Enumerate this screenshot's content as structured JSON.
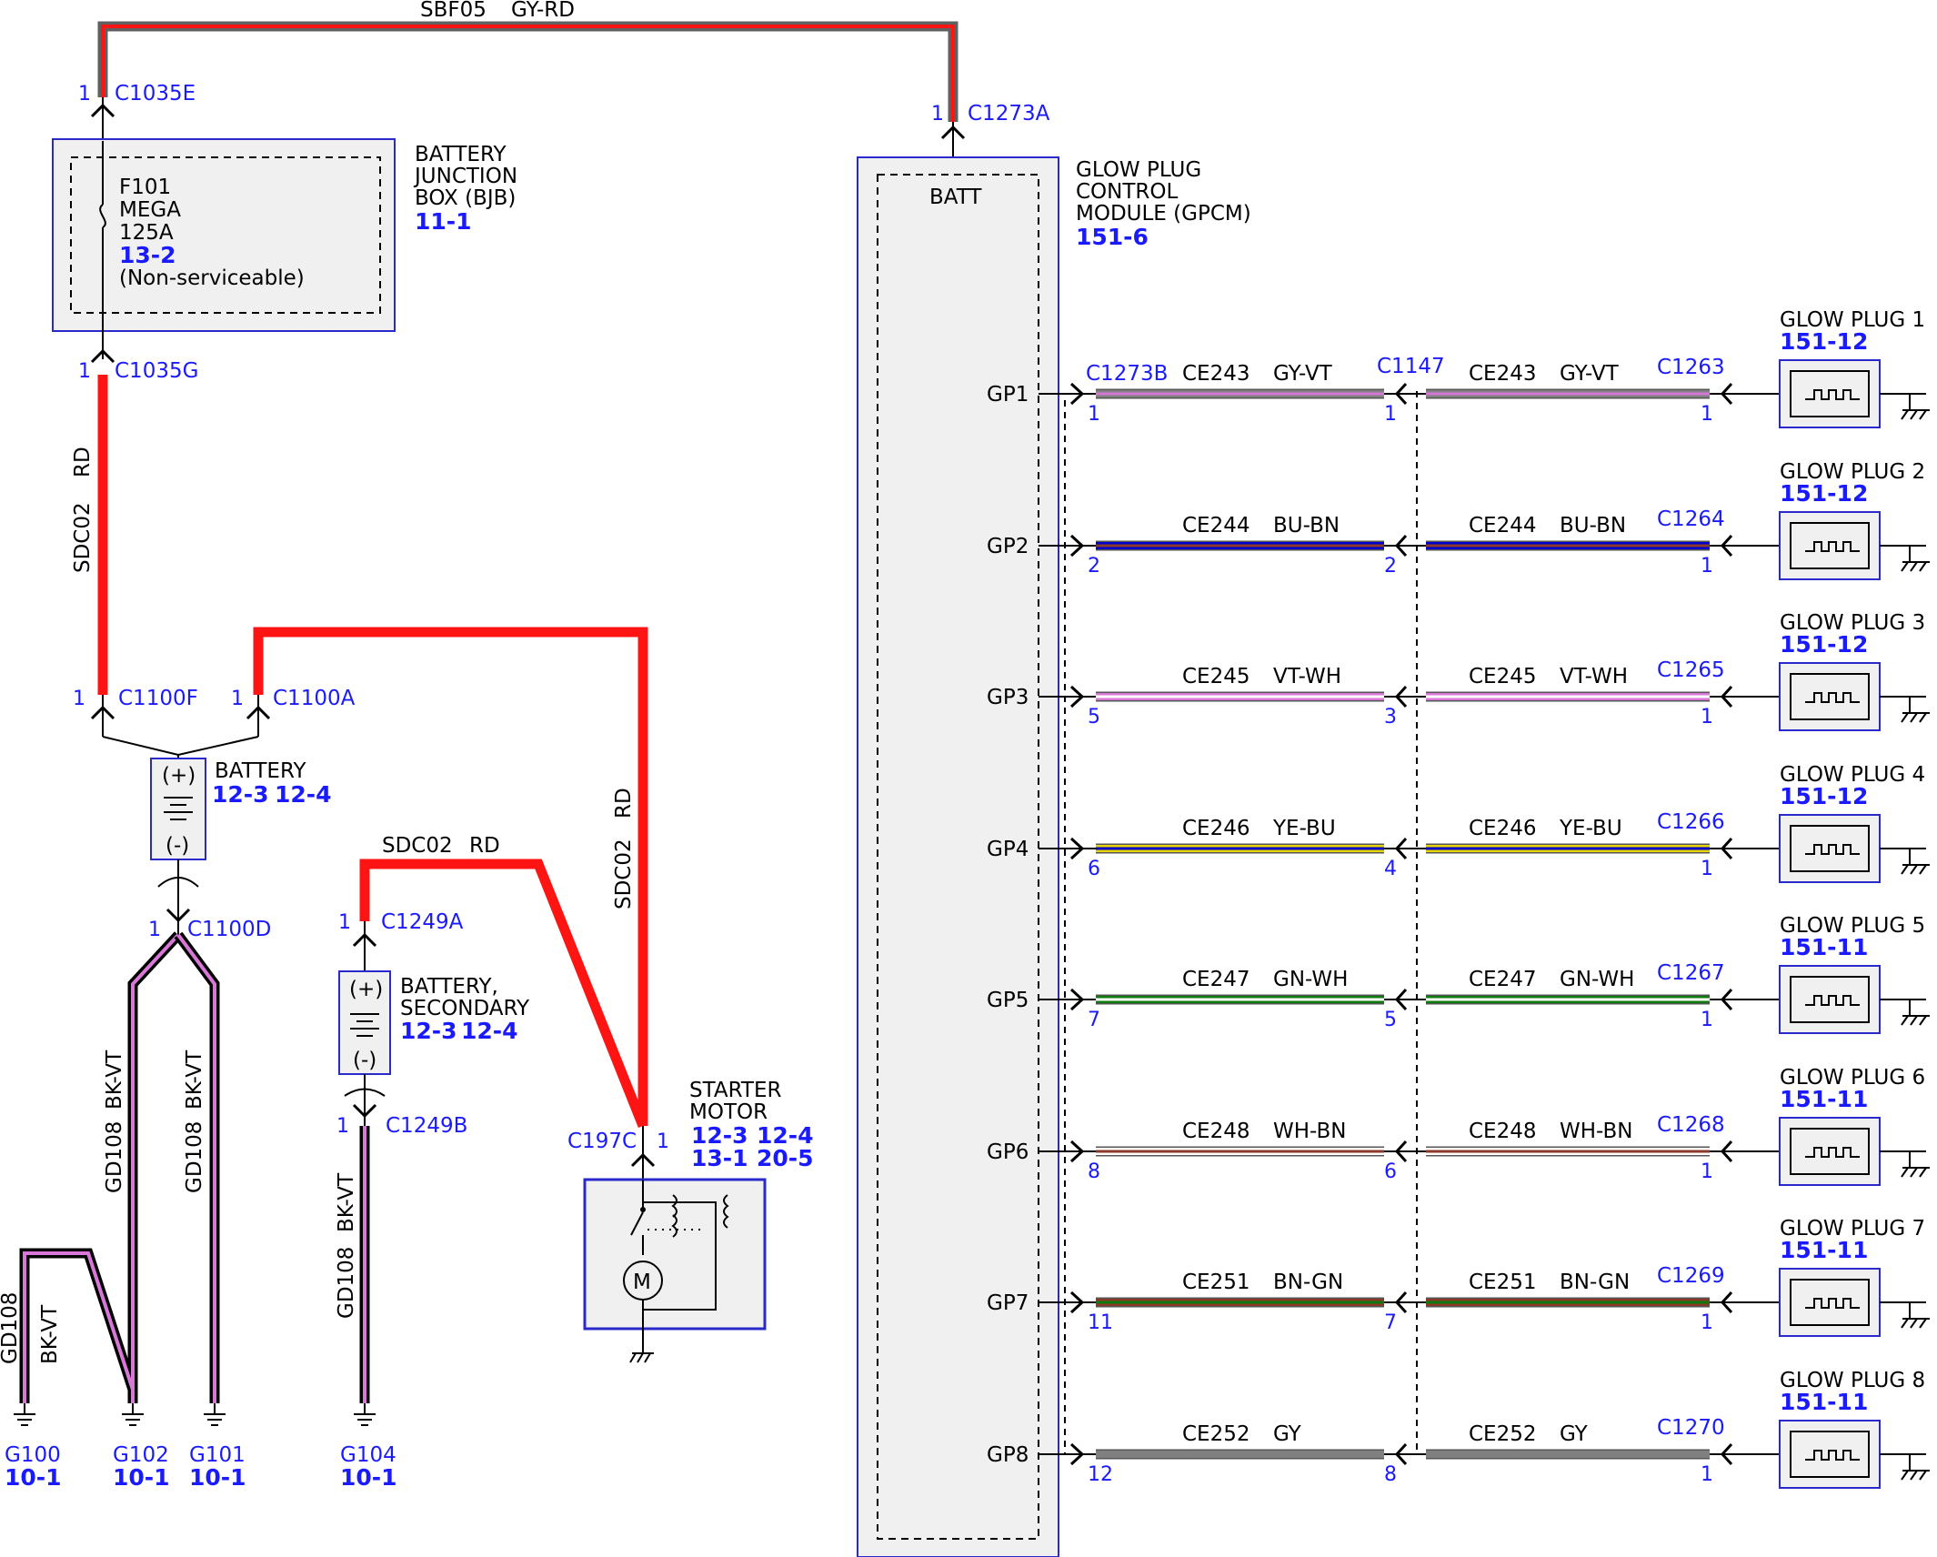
{
  "colors": {
    "red": "#ff1414",
    "gy": "#808080",
    "vt": "#d977d9",
    "bu": "#0000cc",
    "bn": "#8b3a2a",
    "gn": "#0e7a0e",
    "ye": "#e6d400",
    "wh": "#ffffff",
    "blue_text": "#1a1aff",
    "module_fill": "#f0f0f0",
    "module_border": "#2a2acc"
  },
  "top_wire": {
    "circuit": "SBF05",
    "color": "GY-RD"
  },
  "bjb": {
    "title_lines": [
      "BATTERY",
      "JUNCTION",
      "BOX (BJB)"
    ],
    "ref": "11-1",
    "fuse_lines": [
      "F101",
      "MEGA",
      "125A"
    ],
    "fuse_ref": "13-2",
    "fuse_note": "(Non-serviceable)",
    "conn_top": {
      "pin": "1",
      "name": "C1035E"
    },
    "conn_bottom": {
      "pin": "1",
      "name": "C1035G"
    }
  },
  "sdc02_vertical": {
    "circuit": "SDC02",
    "color": "RD"
  },
  "c1100f": {
    "pin": "1",
    "name": "C1100F"
  },
  "c1100a": {
    "pin": "1",
    "name": "C1100A"
  },
  "battery": {
    "title": "BATTERY",
    "refs": [
      "12-3",
      "12-4"
    ],
    "plus": "(+)",
    "minus": "(-)"
  },
  "c1100d": {
    "pin": "1",
    "name": "C1100D"
  },
  "ground_wires": {
    "circuit": "GD108",
    "color": "BK-VT"
  },
  "grounds": [
    {
      "name": "G100",
      "ref": "10-1"
    },
    {
      "name": "G102",
      "ref": "10-1"
    },
    {
      "name": "G101",
      "ref": "10-1"
    },
    {
      "name": "G104",
      "ref": "10-1"
    }
  ],
  "secondary_battery": {
    "title_lines": [
      "BATTERY,",
      "SECONDARY"
    ],
    "refs": [
      "12-3",
      "12-4"
    ],
    "plus": "(+)",
    "minus": "(-)",
    "conn_top": {
      "pin": "1",
      "name": "C1249A"
    },
    "conn_bottom": {
      "pin": "1",
      "name": "C1249B"
    }
  },
  "sdc02_diag": {
    "circuit": "SDC02",
    "color": "RD"
  },
  "sdc02_right": {
    "circuit": "SDC02",
    "color": "RD"
  },
  "starter": {
    "title_lines": [
      "STARTER",
      "MOTOR"
    ],
    "refs_row1": [
      "12-3",
      "12-4"
    ],
    "refs_row2": [
      "13-1",
      "20-5"
    ],
    "conn": {
      "name": "C197C",
      "pin": "1"
    },
    "motor_letter": "M"
  },
  "gpcm": {
    "title_lines": [
      "GLOW PLUG",
      "CONTROL",
      "MODULE (GPCM)"
    ],
    "ref": "151-6",
    "batt": "BATT",
    "conn_batt": {
      "pin": "1",
      "name": "C1273A"
    },
    "left_conn": "C1273B",
    "mid_conn": "C1147"
  },
  "glow_plugs": [
    {
      "gp": "GP1",
      "circuit": "CE243",
      "color": "GY-VT",
      "pin_a": "1",
      "pin_b": "1",
      "pin_c": "1",
      "conn": "C1263",
      "title": "GLOW PLUG 1",
      "ref": "151-12"
    },
    {
      "gp": "GP2",
      "circuit": "CE244",
      "color": "BU-BN",
      "pin_a": "2",
      "pin_b": "2",
      "pin_c": "1",
      "conn": "C1264",
      "title": "GLOW PLUG 2",
      "ref": "151-12"
    },
    {
      "gp": "GP3",
      "circuit": "CE245",
      "color": "VT-WH",
      "pin_a": "5",
      "pin_b": "3",
      "pin_c": "1",
      "conn": "C1265",
      "title": "GLOW PLUG 3",
      "ref": "151-12"
    },
    {
      "gp": "GP4",
      "circuit": "CE246",
      "color": "YE-BU",
      "pin_a": "6",
      "pin_b": "4",
      "pin_c": "1",
      "conn": "C1266",
      "title": "GLOW PLUG 4",
      "ref": "151-12"
    },
    {
      "gp": "GP5",
      "circuit": "CE247",
      "color": "GN-WH",
      "pin_a": "7",
      "pin_b": "5",
      "pin_c": "1",
      "conn": "C1267",
      "title": "GLOW PLUG 5",
      "ref": "151-11"
    },
    {
      "gp": "GP6",
      "circuit": "CE248",
      "color": "WH-BN",
      "pin_a": "8",
      "pin_b": "6",
      "pin_c": "1",
      "conn": "C1268",
      "title": "GLOW PLUG 6",
      "ref": "151-11"
    },
    {
      "gp": "GP7",
      "circuit": "CE251",
      "color": "BN-GN",
      "pin_a": "11",
      "pin_b": "7",
      "pin_c": "1",
      "conn": "C1269",
      "title": "GLOW PLUG 7",
      "ref": "151-11"
    },
    {
      "gp": "GP8",
      "circuit": "CE252",
      "color": "GY",
      "pin_a": "12",
      "pin_b": "8",
      "pin_c": "1",
      "conn": "C1270",
      "title": "GLOW PLUG 8",
      "ref": "151-11"
    }
  ]
}
